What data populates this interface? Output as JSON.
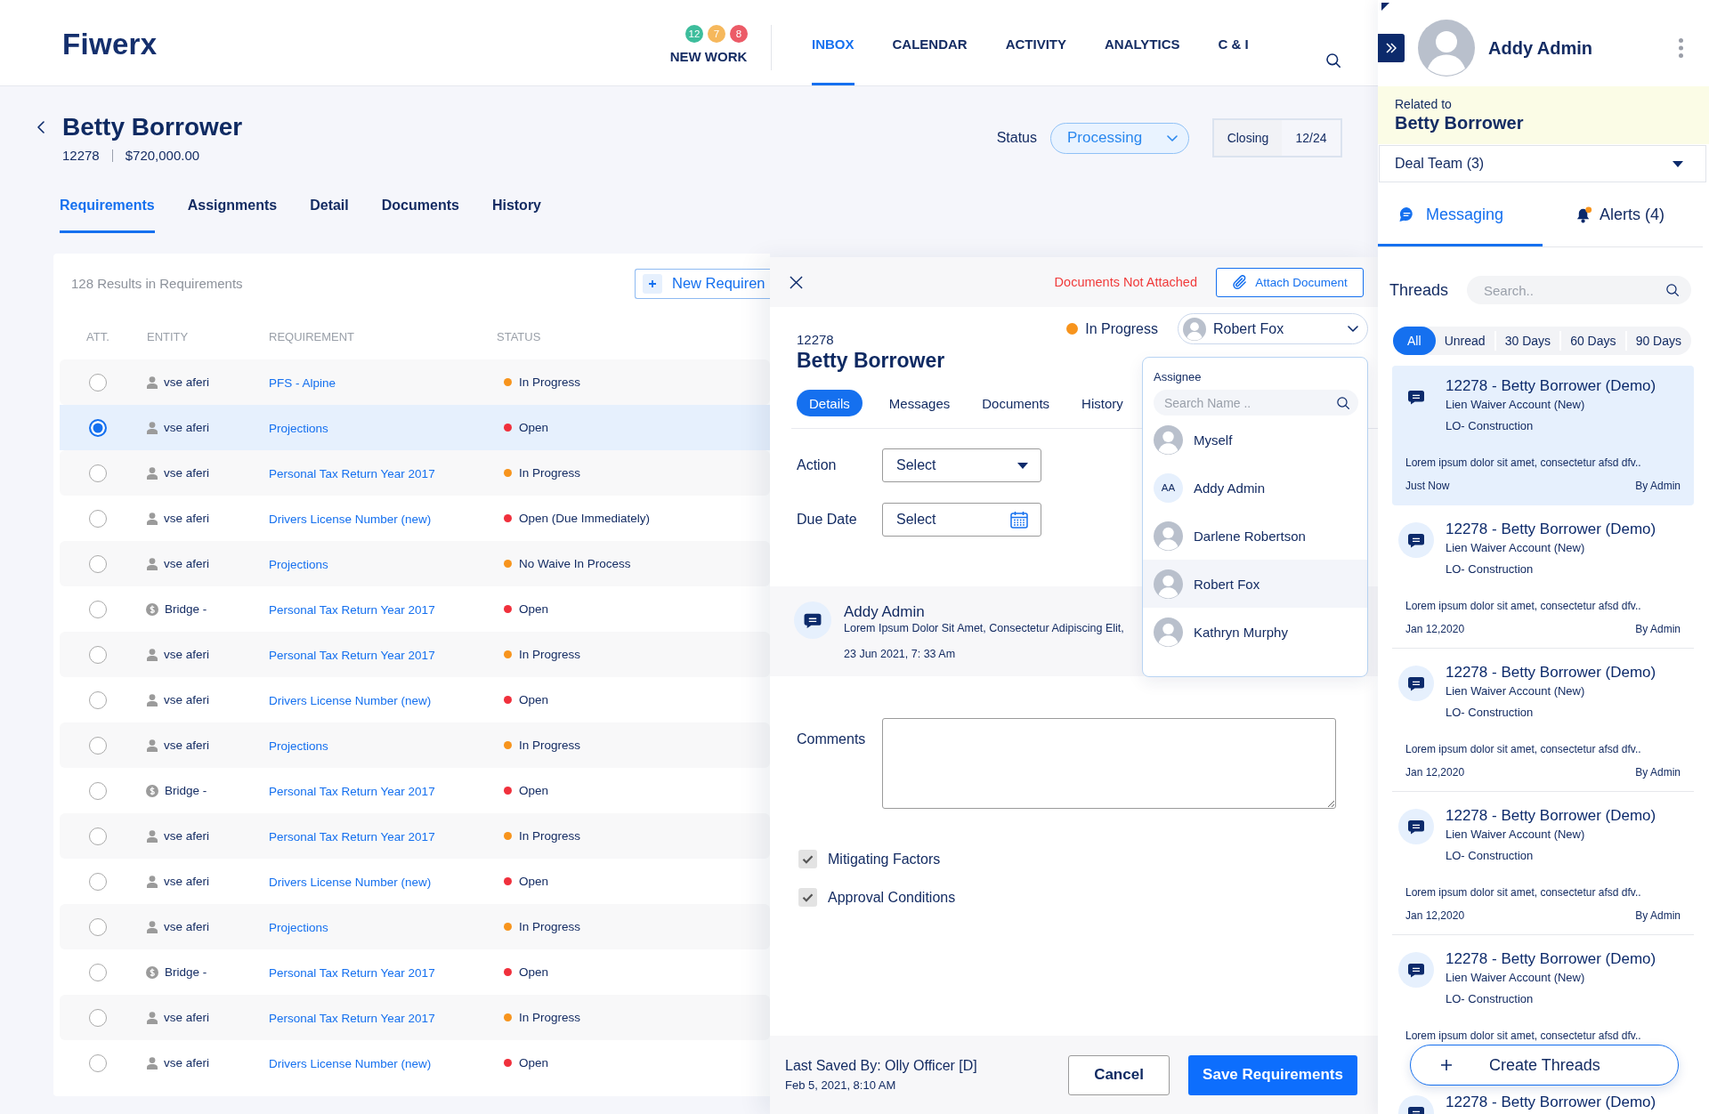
{
  "header": {
    "logo": "Fiwerx",
    "badges": [
      {
        "count": "12",
        "color": "#3dbd9c"
      },
      {
        "count": "7",
        "color": "#f6b85c"
      },
      {
        "count": "8",
        "color": "#ec5b67"
      }
    ],
    "new_work": "NEW WORK",
    "nav": [
      {
        "label": "INBOX",
        "selected": true
      },
      {
        "label": "CALENDAR",
        "selected": false
      },
      {
        "label": "ACTIVITY",
        "selected": false
      },
      {
        "label": "ANALYTICS",
        "selected": false
      },
      {
        "label": "C & I",
        "selected": false
      }
    ]
  },
  "record": {
    "name": "Betty Borrower",
    "id": "12278",
    "amount": "$720,000.00",
    "status_label": "Status",
    "status": "Processing",
    "closing_label": "Closing",
    "closing": "12/24"
  },
  "tabs": [
    {
      "label": "Requirements",
      "selected": true
    },
    {
      "label": "Assignments",
      "selected": false
    },
    {
      "label": "Detail",
      "selected": false
    },
    {
      "label": "Documents",
      "selected": false
    },
    {
      "label": "History",
      "selected": false
    }
  ],
  "requirements": {
    "results": "128 Results in Requirements",
    "new_button": "New Requiren",
    "columns": [
      "ATT.",
      "ENTITY",
      "REQUIREMENT",
      "STATUS"
    ],
    "rows": [
      {
        "selected": false,
        "entity": {
          "kind": "person",
          "name": "vse aferi"
        },
        "requirement": "PFS - Alpine",
        "status": "In Progress",
        "color": "#f7941d"
      },
      {
        "selected": true,
        "entity": {
          "kind": "person",
          "name": "vse aferi"
        },
        "requirement": "Projections",
        "status": "Open",
        "color": "#f0303c"
      },
      {
        "selected": false,
        "entity": {
          "kind": "person",
          "name": "vse aferi"
        },
        "requirement": "Personal Tax Return Year 2017",
        "status": "In Progress",
        "color": "#f7941d"
      },
      {
        "selected": false,
        "entity": {
          "kind": "person",
          "name": "vse aferi"
        },
        "requirement": "Drivers License Number (new)",
        "status": "Open (Due Immediately)",
        "color": "#f0303c"
      },
      {
        "selected": false,
        "entity": {
          "kind": "person",
          "name": "vse aferi"
        },
        "requirement": "Projections",
        "status": "No Waive In Process",
        "color": "#f7941d"
      },
      {
        "selected": false,
        "entity": {
          "kind": "coin",
          "name": "Bridge -"
        },
        "requirement": "Personal Tax Return Year 2017",
        "status": "Open",
        "color": "#f0303c"
      },
      {
        "selected": false,
        "entity": {
          "kind": "person",
          "name": "vse aferi"
        },
        "requirement": "Personal Tax Return Year 2017",
        "status": "In Progress",
        "color": "#f7941d"
      },
      {
        "selected": false,
        "entity": {
          "kind": "person",
          "name": "vse aferi"
        },
        "requirement": "Drivers License Number (new)",
        "status": "Open",
        "color": "#f0303c"
      },
      {
        "selected": false,
        "entity": {
          "kind": "person",
          "name": "vse aferi"
        },
        "requirement": "Projections",
        "status": "In Progress",
        "color": "#f7941d"
      },
      {
        "selected": false,
        "entity": {
          "kind": "coin",
          "name": "Bridge -"
        },
        "requirement": "Personal Tax Return Year 2017",
        "status": "Open",
        "color": "#f0303c"
      },
      {
        "selected": false,
        "entity": {
          "kind": "person",
          "name": "vse aferi"
        },
        "requirement": "Personal Tax Return Year 2017",
        "status": "In Progress",
        "color": "#f7941d"
      },
      {
        "selected": false,
        "entity": {
          "kind": "person",
          "name": "vse aferi"
        },
        "requirement": "Drivers License Number (new)",
        "status": "Open",
        "color": "#f0303c"
      },
      {
        "selected": false,
        "entity": {
          "kind": "person",
          "name": "vse aferi"
        },
        "requirement": "Projections",
        "status": "In Progress",
        "color": "#f7941d"
      },
      {
        "selected": false,
        "entity": {
          "kind": "coin",
          "name": "Bridge -"
        },
        "requirement": "Personal Tax Return Year 2017",
        "status": "Open",
        "color": "#f0303c"
      },
      {
        "selected": false,
        "entity": {
          "kind": "person",
          "name": "vse aferi"
        },
        "requirement": "Personal Tax Return Year 2017",
        "status": "In Progress",
        "color": "#f7941d"
      },
      {
        "selected": false,
        "entity": {
          "kind": "person",
          "name": "vse aferi"
        },
        "requirement": "Drivers License Number (new)",
        "status": "Open",
        "color": "#f0303c"
      }
    ]
  },
  "detail_panel": {
    "warning": "Documents Not Attached",
    "attach_button": "Attach Document",
    "status": "In Progress",
    "color": "#f7941d",
    "assignee": "Robert Fox",
    "id": "12278",
    "name": "Betty Borrower",
    "tabs": [
      {
        "label": "Details",
        "selected": true
      },
      {
        "label": "Messages",
        "selected": false
      },
      {
        "label": "Documents",
        "selected": false
      },
      {
        "label": "History",
        "selected": false
      }
    ],
    "form": [
      {
        "label": "Action",
        "kind": "dropdown",
        "value": "Select"
      },
      {
        "label": "Due Date",
        "kind": "date",
        "value": "Select"
      }
    ],
    "message": {
      "author": "Addy Admin",
      "text": "Lorem Ipsum Dolor Sit Amet, Consectetur Adipiscing Elit,",
      "time": "23 Jun 2021, 7: 33 Am"
    },
    "comments_label": "Comments",
    "checkboxes": [
      {
        "label": "Mitigating Factors",
        "checked": true
      },
      {
        "label": "Approval Conditions",
        "checked": true
      }
    ],
    "last_saved": "Last Saved By: Olly Officer [D]",
    "saved_at": "Feb 5, 2021, 8:10 AM",
    "buttons": [
      {
        "label": "Cancel",
        "kind": "secondary"
      },
      {
        "label": "Save Requirements",
        "kind": "primary"
      }
    ]
  },
  "assignee_menu": {
    "title": "Assignee",
    "placeholder": "Search Name ..",
    "options": [
      {
        "name": "Myself",
        "kind": "photo",
        "selected": false
      },
      {
        "name": "Addy Admin",
        "kind": "initials",
        "initials": "AA",
        "selected": false
      },
      {
        "name": "Darlene Robertson",
        "kind": "photo",
        "selected": false
      },
      {
        "name": "Robert Fox",
        "kind": "photo",
        "selected": true
      },
      {
        "name": "Kathryn Murphy",
        "kind": "photo",
        "selected": false
      }
    ]
  },
  "sidebar": {
    "user": "Addy Admin",
    "related_label": "Related to",
    "related_name": "Betty Borrower",
    "deal_team": "Deal Team (3)",
    "tabs": [
      {
        "label": "Messaging",
        "kind": "messaging",
        "selected": true
      },
      {
        "label": "Alerts (4)",
        "kind": "alerts",
        "selected": false
      }
    ],
    "threads_label": "Threads",
    "search_placeholder": "Search..",
    "filters": [
      {
        "label": "All",
        "selected": true
      },
      {
        "label": "Unread",
        "selected": false
      },
      {
        "label": "30 Days",
        "selected": false
      },
      {
        "label": "60 Days",
        "selected": false
      },
      {
        "label": "90 Days",
        "selected": false
      }
    ],
    "threads": [
      {
        "title": "12278 - Betty Borrower (Demo)",
        "account": "Lien Waiver Account (New)",
        "group": "LO- Construction",
        "preview": "Lorem ipsum dolor sit amet, consectetur afsd dfv..",
        "time": "Just Now",
        "by": "By Admin",
        "selected": true
      },
      {
        "title": "12278 - Betty Borrower (Demo)",
        "account": "Lien Waiver Account (New)",
        "group": "LO- Construction",
        "preview": "Lorem ipsum dolor sit amet, consectetur afsd dfv..",
        "time": "Jan 12,2020",
        "by": "By Admin",
        "selected": false
      },
      {
        "title": "12278 - Betty Borrower (Demo)",
        "account": "Lien Waiver Account (New)",
        "group": "LO- Construction",
        "preview": "Lorem ipsum dolor sit amet, consectetur afsd dfv..",
        "time": "Jan 12,2020",
        "by": "By Admin",
        "selected": false
      },
      {
        "title": "12278 - Betty Borrower (Demo)",
        "account": "Lien Waiver Account (New)",
        "group": "LO- Construction",
        "preview": "Lorem ipsum dolor sit amet, consectetur afsd dfv..",
        "time": "Jan 12,2020",
        "by": "By Admin",
        "selected": false
      },
      {
        "title": "12278 - Betty Borrower (Demo)",
        "account": "Lien Waiver Account (New)",
        "group": "LO- Construction",
        "preview": "Lorem ipsum dolor sit amet, consectetur afsd dfv..",
        "selected": false
      },
      {
        "title": "12278 - Betty Borrower (Demo)",
        "selected": false
      }
    ],
    "create_button": "Create Threads"
  }
}
